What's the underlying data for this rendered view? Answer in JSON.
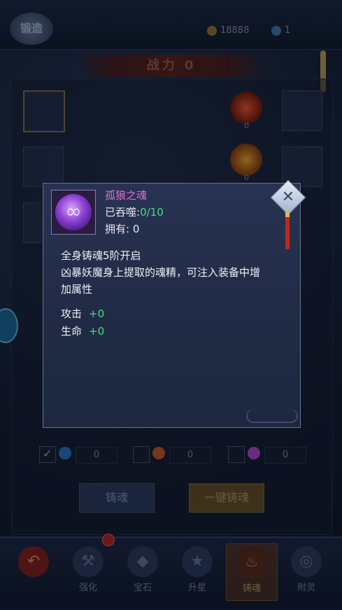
{
  "top": {
    "forge_label": "锻造",
    "gold": "18888",
    "gems": "1"
  },
  "power": {
    "label": "战力",
    "value": "0"
  },
  "orb_counts": [
    "0",
    "0"
  ],
  "gem_rows": [
    {
      "value": "0",
      "checked": true,
      "color": "#2a78c8"
    },
    {
      "value": "0",
      "checked": false,
      "color": "#d8542a"
    },
    {
      "value": "0",
      "checked": false,
      "color": "#b44ad8"
    }
  ],
  "buttons": {
    "cast_soul": "铸魂",
    "one_click_cast": "一键铸魂"
  },
  "tabs": [
    {
      "label": "强化",
      "icon": "anvil-icon"
    },
    {
      "label": "宝石",
      "icon": "gem-icon"
    },
    {
      "label": "升星",
      "icon": "star-icon"
    },
    {
      "label": "铸魂",
      "icon": "cauldron-icon",
      "active": true
    },
    {
      "label": "附灵",
      "icon": "swirl-icon"
    }
  ],
  "modal": {
    "item_name": "孤狼之魂",
    "devoured_label": "已吞噬:",
    "devoured_value": "0/10",
    "owned_label": "拥有:",
    "owned_value": "0",
    "desc_line1": "全身铸魂5阶开启",
    "desc_line2": "凶暴妖魔身上提取的魂精，可注入装备中增",
    "desc_line3": "加属性",
    "attack_label": "攻击",
    "attack_value": "+0",
    "hp_label": "生命",
    "hp_value": "+0"
  },
  "colors": {
    "item_name": "#e36ad8",
    "positive": "#44e27a",
    "accent_gold": "#c09a58"
  }
}
